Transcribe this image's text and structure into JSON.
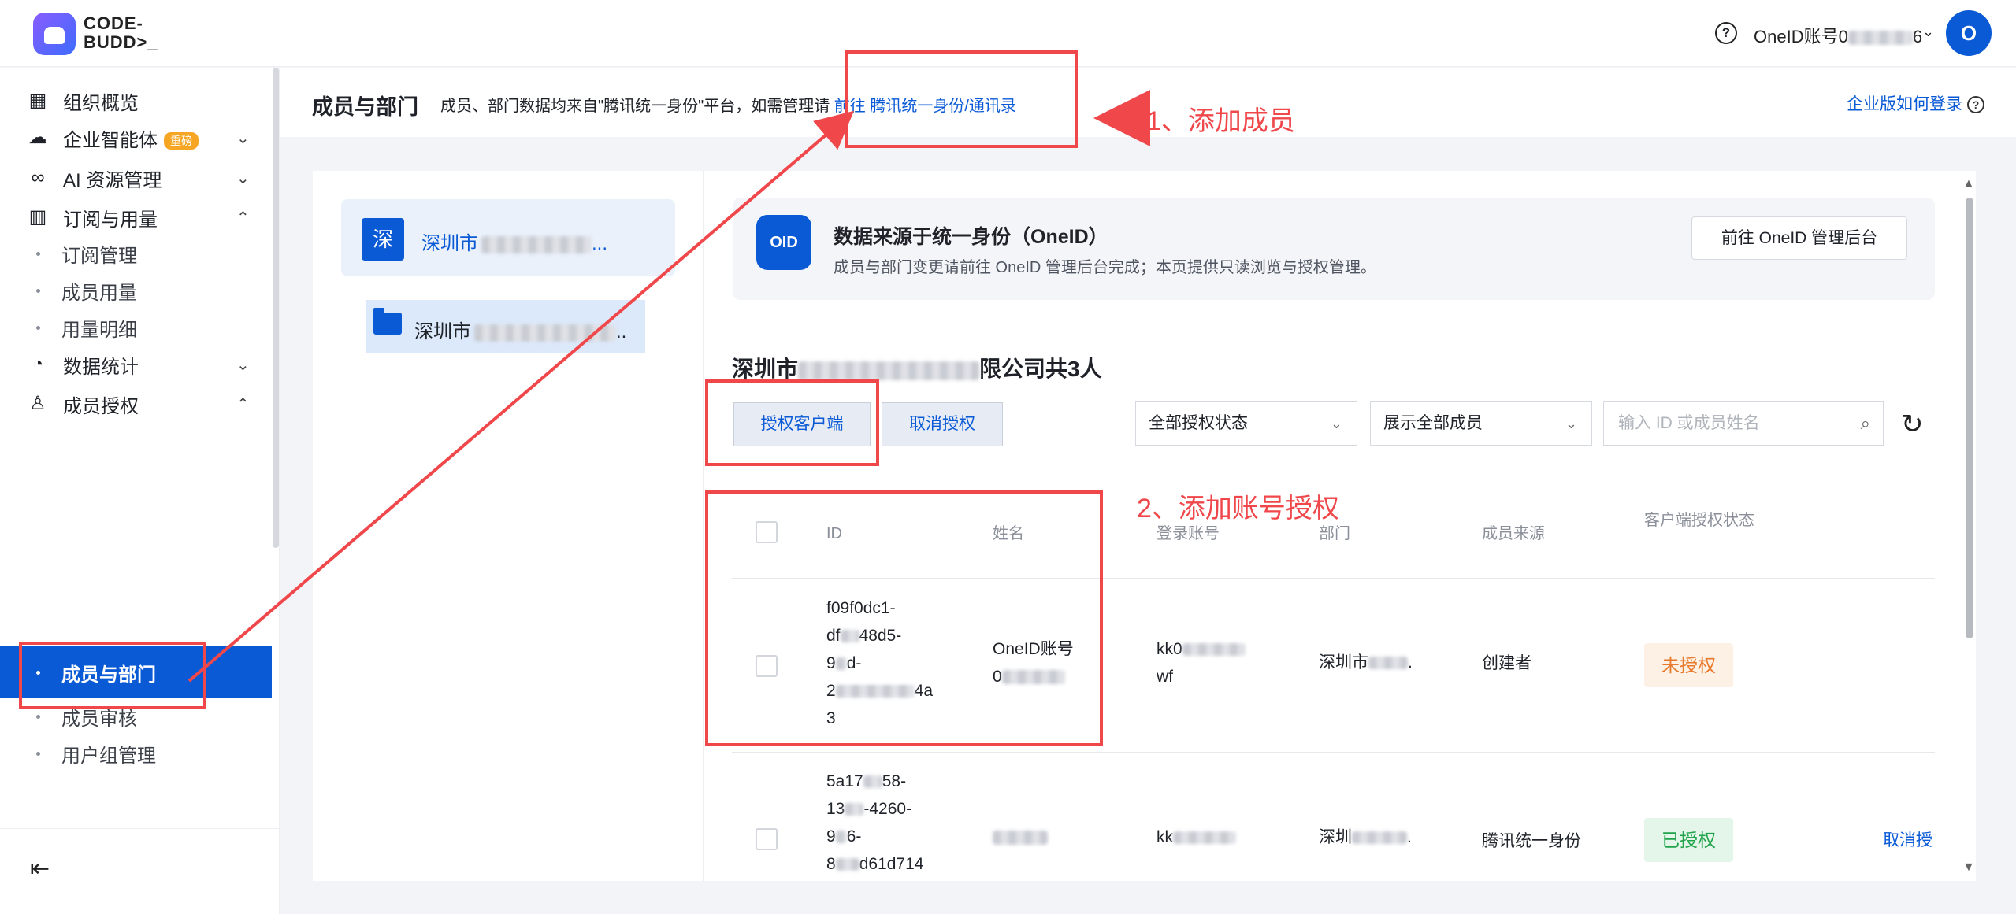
{
  "app": {
    "logo_text_line1": "CODE-",
    "logo_text_line2": "BUDD>_",
    "account_label": "OneID账号0",
    "avatar_letter": "O"
  },
  "sidebar": {
    "items": [
      {
        "label": "组织概览",
        "icon": "grid-icon"
      },
      {
        "label": "企业智能体",
        "badge": "重磅",
        "icon": "cloud-icon"
      },
      {
        "label": "AI 资源管理",
        "icon": "infinity-icon"
      },
      {
        "label": "订阅与用量",
        "icon": "bar-chart-icon"
      },
      {
        "label": "订阅管理"
      },
      {
        "label": "成员用量"
      },
      {
        "label": "用量明细"
      },
      {
        "label": "数据统计",
        "icon": "pie-chart-icon"
      },
      {
        "label": "成员授权",
        "icon": "user-icon"
      },
      {
        "label": "成员与部门"
      },
      {
        "label": "成员审核"
      },
      {
        "label": "用户组管理"
      }
    ]
  },
  "header": {
    "title": "成员与部门",
    "desc": "成员、部门数据均来自\"腾讯统一身份\"平台，如需管理请",
    "link": "前往 腾讯统一身份/通讯录",
    "right_link": "企业版如何登录"
  },
  "org": {
    "root_initial": "深",
    "root_name": "深圳市",
    "child_name": "深圳市"
  },
  "notice": {
    "badge": "OID",
    "title": "数据来源于统一身份（OneID）",
    "desc": "成员与部门变更请前往 OneID 管理后台完成；本页提供只读浏览与授权管理。",
    "button": "前往 OneID 管理后台"
  },
  "company": {
    "prefix": "深圳市",
    "suffix": "限公司共3人"
  },
  "toolbar": {
    "auth_button": "授权客户端",
    "cancel_button": "取消授权",
    "status_select": "全部授权状态",
    "member_select": "展示全部成员",
    "search_placeholder": "输入 ID 或成员姓名"
  },
  "table": {
    "headers": [
      "ID",
      "姓名",
      "登录账号",
      "部门",
      "成员来源",
      "客户端授权状态"
    ],
    "rows": [
      {
        "id_lines": [
          "f09f0dc1-",
          "df",
          "48d5-",
          "9",
          "d-",
          "2",
          "4a",
          "3"
        ],
        "name": "OneID账号",
        "name2": "0",
        "account": "kk0",
        "account2": "wf",
        "dept": "深圳市",
        "source": "创建者",
        "status": "未授权"
      },
      {
        "id_lines": [
          "5a17",
          "58-",
          "13",
          "-4260-",
          "9",
          "6-",
          "8",
          "d61d714"
        ],
        "account": "kk",
        "dept": "深圳",
        "source": "腾讯统一身份",
        "status": "已授权",
        "action": "取消授"
      }
    ]
  },
  "annotations": {
    "step1": "1、添加成员",
    "step2": "2、添加账号授权",
    "color": "#f0474b"
  }
}
